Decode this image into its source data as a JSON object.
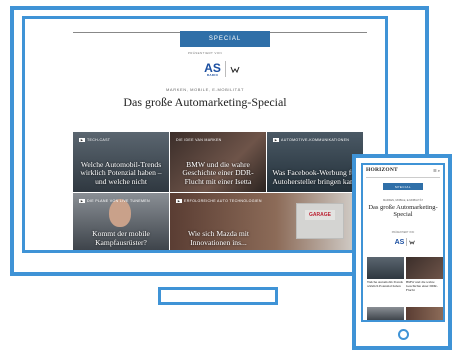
{
  "desktop": {
    "special_label": "SPECIAL",
    "presented_by": "PRÄSENTIERT VON",
    "logos": {
      "as_text": "AS",
      "as_sub": "RADIO",
      "vw_sub": "VOLKSWAGEN"
    },
    "kicker": "MARKEN, MOBILE, E-MOBILITÄT",
    "headline": "Das große Automarketing-Special",
    "tiles": [
      {
        "tag": "TECH-CAST",
        "title": "Welche Automobil-Trends wirklich Potenzial haben – und welche nicht"
      },
      {
        "tag": "DIE IDEE VAN MARKEN",
        "title": "BMW und die wahre Geschichte einer DDR-Flucht mit einer Isetta"
      },
      {
        "tag": "AUTOMOTIVE-KOMMUNIKATIONEN",
        "title": "Was Facebook-Werbung für Autohersteller bringen kann"
      },
      {
        "tag": "DIE PLANE VON LIVE TUNEMEN",
        "title": "Kommt der mobile Kampfausrüster?"
      },
      {
        "tag": "ERFOLGREICHE AUTO TECHNOLOGIEN",
        "title": "Wie sich Mazda mit Innovationen ins..."
      }
    ],
    "garage_sign": "GARAGE"
  },
  "mobile": {
    "brand": "HORIZONT",
    "menu": "☰ ⌕",
    "special_label": "SPECIAL",
    "kicker": "MARKEN, MOBILE, E-MOBILITÄT",
    "headline": "Das große Automarketing-Special",
    "presented_by": "PRÄSENTIERT VON",
    "logos": {
      "as_text": "AS"
    },
    "captions": [
      "Welche Automobil-Trends wirklich Potenzial haben",
      "BMW und die wahre Geschichte einer DDR-Flucht"
    ]
  },
  "colors": {
    "frame": "#3f93d6",
    "badge": "#2f6fa8"
  }
}
